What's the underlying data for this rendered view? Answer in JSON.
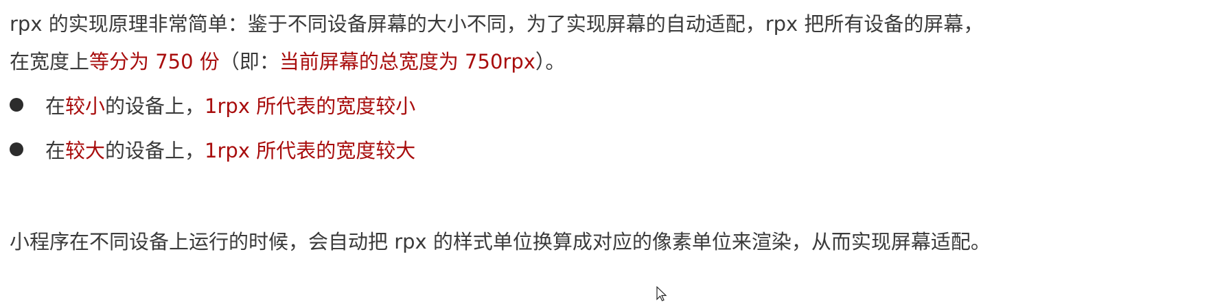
{
  "paragraph1": {
    "line1": "rpx 的实现原理非常简单：鉴于不同设备屏幕的大小不同，为了实现屏幕的自动适配，rpx 把所有设备的屏幕，",
    "line2_part1": "在宽度上",
    "line2_red1": "等分为 750 份",
    "line2_part2": "（即：",
    "line2_red2": "当前屏幕的总宽度为 750rpx",
    "line2_part3": "）。"
  },
  "bullets": [
    {
      "part1": "在",
      "red1": "较小",
      "part2": "的设备上，",
      "red2": "1rpx 所代表的宽度较小"
    },
    {
      "part1": "在",
      "red1": "较大",
      "part2": "的设备上，",
      "red2": "1rpx 所代表的宽度较大"
    }
  ],
  "paragraph2": "小程序在不同设备上运行的时候，会自动把 rpx 的样式单位换算成对应的像素单位来渲染，从而实现屏幕适配。",
  "colors": {
    "text": "#3a3a3a",
    "highlight": "#a80d0d",
    "bullet": "#2c2c2c",
    "background": "#ffffff"
  },
  "icons": {
    "cursor": "mouse-pointer-icon"
  }
}
